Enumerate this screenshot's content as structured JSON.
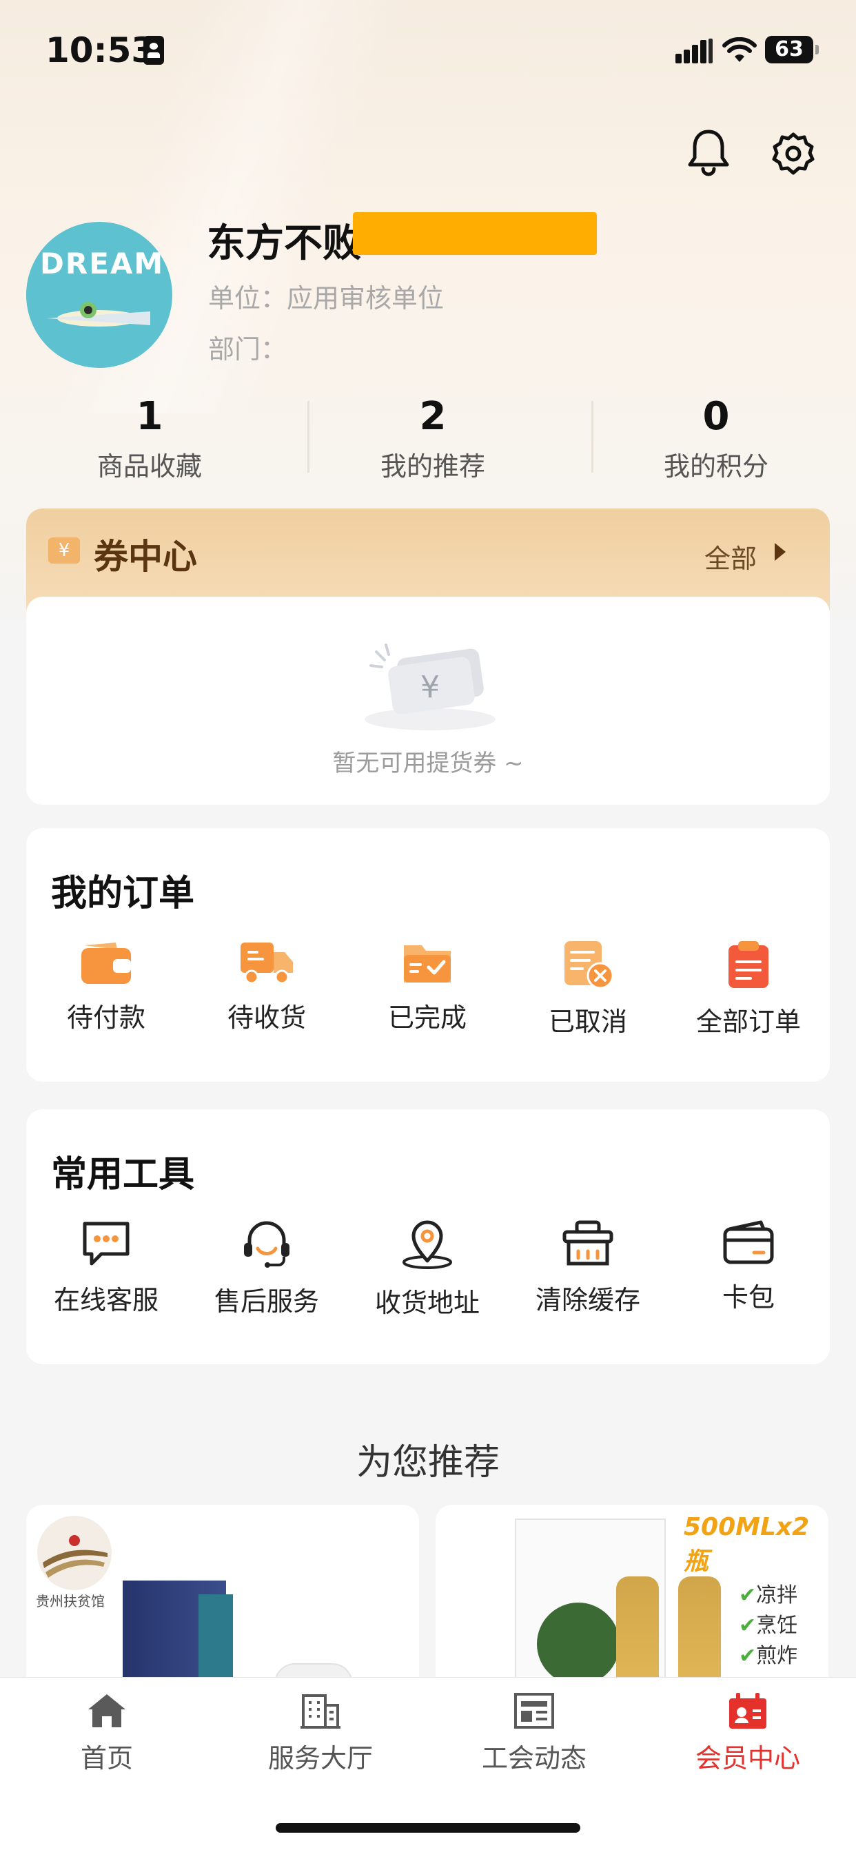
{
  "status_bar": {
    "time": "10:53",
    "battery": "63"
  },
  "profile": {
    "name": "东方不败",
    "unit_label": "单位：应用审核单位",
    "dept_label": "部门："
  },
  "avatar_text": "DREAM",
  "stats": [
    {
      "value": "1",
      "label": "商品收藏"
    },
    {
      "value": "2",
      "label": "我的推荐"
    },
    {
      "value": "0",
      "label": "我的积分"
    }
  ],
  "coupon": {
    "title": "券中心",
    "all_label": "全部",
    "empty_text": "暂无可用提货券 ~",
    "icon_glyph": "¥"
  },
  "orders": {
    "title": "我的订单",
    "items": [
      {
        "label": "待付款",
        "icon": "wallet-icon"
      },
      {
        "label": "待收货",
        "icon": "truck-icon"
      },
      {
        "label": "已完成",
        "icon": "completed-icon"
      },
      {
        "label": "已取消",
        "icon": "cancelled-icon"
      },
      {
        "label": "全部订单",
        "icon": "clipboard-icon"
      }
    ]
  },
  "tools": {
    "title": "常用工具",
    "items": [
      {
        "label": "在线客服",
        "icon": "chat-icon"
      },
      {
        "label": "售后服务",
        "icon": "headset-icon"
      },
      {
        "label": "收货地址",
        "icon": "location-icon"
      },
      {
        "label": "清除缓存",
        "icon": "basket-icon"
      },
      {
        "label": "卡包",
        "icon": "card-icon"
      }
    ]
  },
  "recommend": {
    "title": "为您推荐",
    "products": [
      {
        "brand_text": "贵州扶贫馆"
      },
      {
        "badge_text": "500MLx2瓶",
        "tags": [
          "凉拌",
          "烹饪",
          "煎炸"
        ]
      }
    ]
  },
  "tabbar": {
    "items": [
      {
        "label": "首页",
        "icon": "home-icon"
      },
      {
        "label": "服务大厅",
        "icon": "building-icon"
      },
      {
        "label": "工会动态",
        "icon": "news-icon"
      },
      {
        "label": "会员中心",
        "icon": "member-icon"
      }
    ],
    "active_index": 3
  },
  "colors": {
    "accent": "#e5312c",
    "orange": "#f7953f",
    "coupon_brown": "#5b3512",
    "redaction": "#ffad00"
  }
}
